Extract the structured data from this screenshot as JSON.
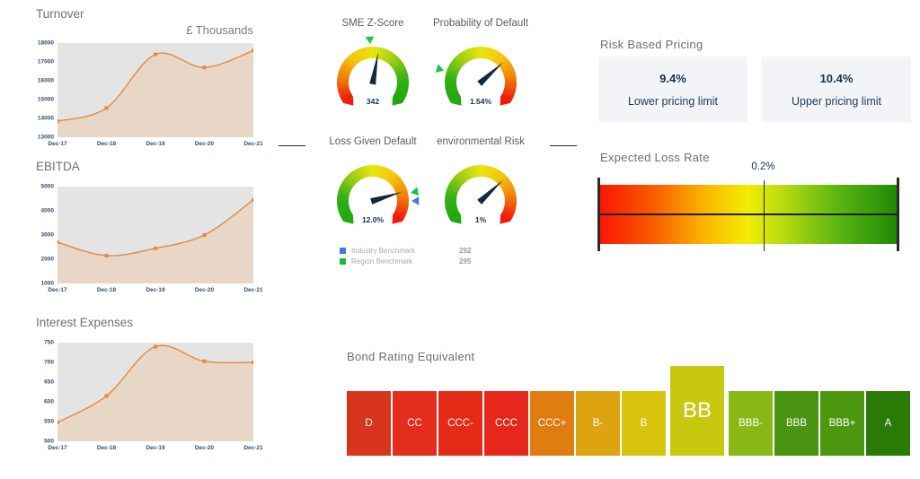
{
  "charts": {
    "turnover": {
      "title": "Turnover",
      "unit": "£ Thousands",
      "categories": [
        "Dec-17",
        "Dec-18",
        "Dec-19",
        "Dec-20",
        "Dec-21"
      ],
      "values": [
        13850,
        14550,
        17400,
        16700,
        17600
      ],
      "yticks": [
        "18000",
        "17000",
        "16000",
        "15000",
        "14000",
        "13000"
      ],
      "ylim": [
        13000,
        18000
      ],
      "line_color": "#e8883a",
      "fill_color": "#e8d7c6",
      "plot_bg": "#e4e4e4"
    },
    "ebitda": {
      "title": "EBITDA",
      "unit": "",
      "categories": [
        "Dec-17",
        "Dec-18",
        "Dec-19",
        "Dec-20",
        "Dec-21"
      ],
      "values": [
        2700,
        2150,
        2450,
        3000,
        4450
      ],
      "yticks": [
        "5000",
        "4000",
        "3000",
        "2000",
        "1000"
      ],
      "ylim": [
        1000,
        5000
      ],
      "line_color": "#e8883a",
      "fill_color": "#e8d7c6",
      "plot_bg": "#e4e4e4"
    },
    "interest_expenses": {
      "title": "Interest Expenses",
      "unit": "",
      "categories": [
        "Dec-17",
        "Dec-18",
        "Dec-19",
        "Dec-20",
        "Dec-21"
      ],
      "values": [
        548,
        615,
        740,
        703,
        700
      ],
      "yticks": [
        "750",
        "700",
        "650",
        "600",
        "550",
        "500"
      ],
      "ylim": [
        500,
        750
      ],
      "line_color": "#e8883a",
      "fill_color": "#e8d7c6",
      "plot_bg": "#e4e4e4"
    }
  },
  "chart_data": [
    {
      "type": "area",
      "title": "Turnover",
      "subtitle": "£ Thousands",
      "xlabel": "",
      "ylabel": "£ Thousands",
      "categories": [
        "Dec-17",
        "Dec-18",
        "Dec-19",
        "Dec-20",
        "Dec-21"
      ],
      "values": [
        13850,
        14550,
        17400,
        16700,
        17600
      ],
      "ylim": [
        13000,
        18000
      ],
      "yticks": [
        13000,
        14000,
        15000,
        16000,
        17000,
        18000
      ],
      "grid": false,
      "legend": "none"
    },
    {
      "type": "area",
      "title": "EBITDA",
      "xlabel": "",
      "ylabel": "",
      "categories": [
        "Dec-17",
        "Dec-18",
        "Dec-19",
        "Dec-20",
        "Dec-21"
      ],
      "values": [
        2700,
        2150,
        2450,
        3000,
        4450
      ],
      "ylim": [
        1000,
        5000
      ],
      "yticks": [
        1000,
        2000,
        3000,
        4000,
        5000
      ],
      "grid": false,
      "legend": "none"
    },
    {
      "type": "area",
      "title": "Interest Expenses",
      "xlabel": "",
      "ylabel": "",
      "categories": [
        "Dec-17",
        "Dec-18",
        "Dec-19",
        "Dec-20",
        "Dec-21"
      ],
      "values": [
        548,
        615,
        740,
        703,
        700
      ],
      "ylim": [
        500,
        750
      ],
      "yticks": [
        500,
        550,
        600,
        650,
        700,
        750
      ],
      "grid": false,
      "legend": "none"
    },
    {
      "type": "bar",
      "title": "Bond Rating Equivalent",
      "categories": [
        "D",
        "CC",
        "CCC-",
        "CCC",
        "CCC+",
        "B-",
        "B",
        "BB",
        "BBB-",
        "BBB",
        "BBB+",
        "A"
      ],
      "values": [
        1,
        1,
        1,
        1,
        1,
        1,
        1,
        1,
        1,
        1,
        1,
        1
      ],
      "highlighted": "BB",
      "xlabel": "",
      "ylabel": "",
      "legend": "none"
    }
  ],
  "gauges": {
    "sme_z_score": {
      "label": "SME Z-Score",
      "value": "342",
      "needle_deg": 10,
      "marker_deg": -4,
      "marker_color": "#24c04e",
      "direction": "red-to-green"
    },
    "probability_of_default": {
      "label": "Probability of Default",
      "value": "1.54%",
      "needle_deg": 48,
      "marker_deg": -72,
      "marker_color": "#24c04e",
      "direction": "green-to-red"
    },
    "loss_given_default": {
      "label": "Loss Given Default",
      "value": "12.0%",
      "needle_deg": 73,
      "marker_deg": 78,
      "marker_color": "#24c04e",
      "marker2_deg": 90,
      "marker2_color": "#3b7ddd",
      "direction": "green-to-red"
    },
    "environmental_risk": {
      "label": "environmental Risk",
      "value": "1%",
      "needle_deg": 47,
      "direction": "green-to-red"
    }
  },
  "benchmarks": {
    "rows": [
      {
        "label": "Industry Benchmark",
        "value": "292",
        "color": "#3b7ddd"
      },
      {
        "label": "Region Benchmark",
        "value": "295",
        "color": "#22b24c"
      }
    ]
  },
  "risk_based_pricing": {
    "title": "Risk Based Pricing",
    "cards": [
      {
        "value": "9.4%",
        "caption": "Lower pricing limit"
      },
      {
        "value": "10.4%",
        "caption": "Upper pricing limit"
      }
    ]
  },
  "expected_loss_rate": {
    "title": "Expected Loss Rate",
    "marker_label": "0.2%",
    "marker_position_pct": 55
  },
  "bond_rating": {
    "title": "Bond Rating Equivalent",
    "active": "BB",
    "cells": [
      {
        "label": "D",
        "color": "#d8351f"
      },
      {
        "label": "CC",
        "color": "#e52d1c"
      },
      {
        "label": "CCC-",
        "color": "#e52a18"
      },
      {
        "label": "CCC",
        "color": "#e5281b"
      },
      {
        "label": "CCC+",
        "color": "#e07d11"
      },
      {
        "label": "B-",
        "color": "#dda310"
      },
      {
        "label": "B",
        "color": "#d8c40c"
      },
      {
        "label": "BB",
        "color": "#c8c811"
      },
      {
        "label": "BBB-",
        "color": "#87b815"
      },
      {
        "label": "BBB",
        "color": "#499410"
      },
      {
        "label": "BBB+",
        "color": "#4d9710"
      },
      {
        "label": "A",
        "color": "#2a7a08"
      }
    ]
  }
}
